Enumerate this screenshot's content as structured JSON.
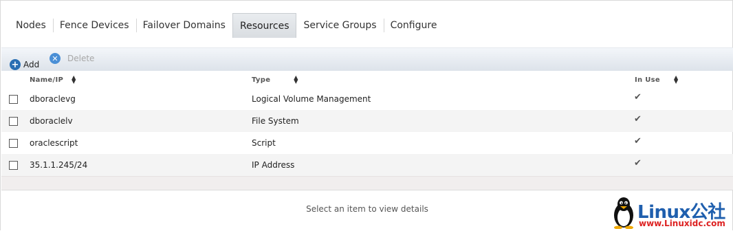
{
  "tabs": [
    {
      "label": "Nodes"
    },
    {
      "label": "Fence Devices"
    },
    {
      "label": "Failover Domains"
    },
    {
      "label": "Resources",
      "active": true
    },
    {
      "label": "Service Groups"
    },
    {
      "label": "Configure"
    }
  ],
  "toolbar": {
    "add_label": "Add",
    "delete_label": "Delete"
  },
  "table": {
    "columns": [
      "Name/IP",
      "Type",
      "In Use"
    ],
    "rows": [
      {
        "name": "dboraclevg",
        "type": "Logical Volume Management",
        "in_use": "✔"
      },
      {
        "name": "dboraclelv",
        "type": "File System",
        "in_use": "✔"
      },
      {
        "name": "oraclescript",
        "type": "Script",
        "in_use": "✔"
      },
      {
        "name": "35.1.1.245/24",
        "type": "IP Address",
        "in_use": "✔"
      }
    ]
  },
  "details": {
    "placeholder": "Select an item to view details"
  },
  "watermark": {
    "brand": "Linux公社",
    "url": "www.Linuxidc.com"
  },
  "colors": {
    "accent": "#2a6fb3",
    "brand": "#1f5fae",
    "url": "#dd2222"
  }
}
